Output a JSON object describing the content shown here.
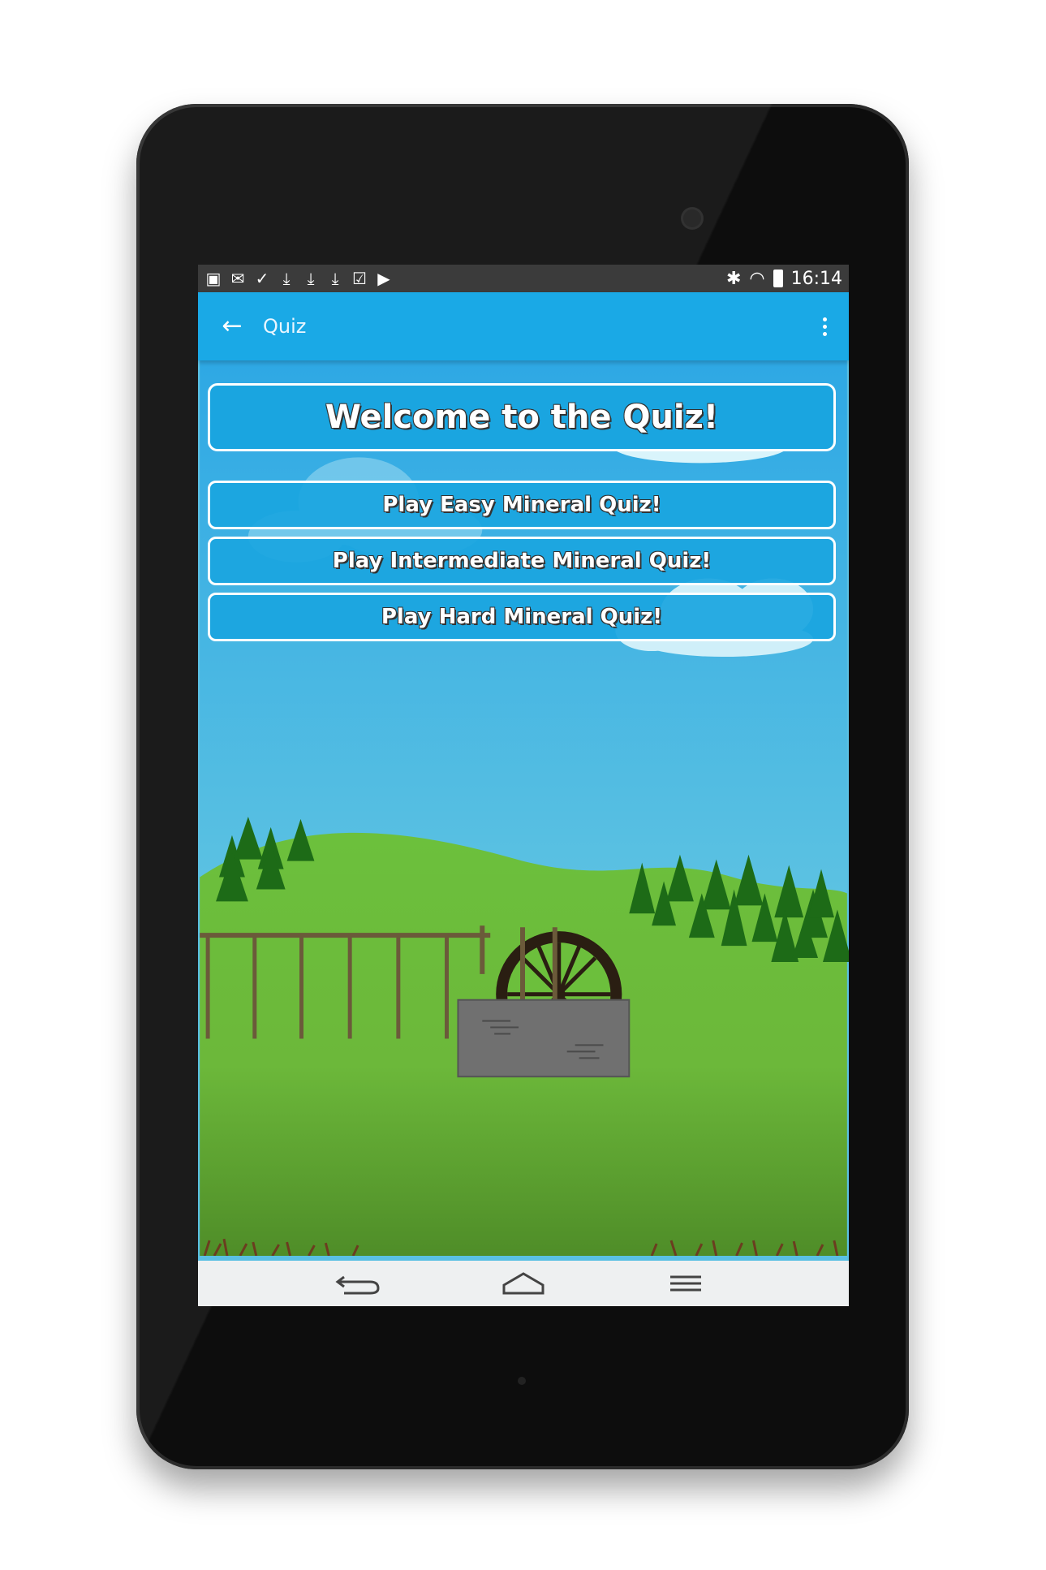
{
  "status_bar": {
    "notification_icons": [
      "image-icon",
      "gmail-icon",
      "check-icon",
      "download-icon",
      "download-icon",
      "download-icon",
      "store-check-icon",
      "store-play-icon"
    ],
    "time": "16:14",
    "system_icons": [
      "bluetooth-icon",
      "wifi-icon",
      "battery-icon"
    ]
  },
  "app_bar": {
    "title": "Quiz",
    "back_icon": "arrow-left-icon",
    "menu_icon": "more-vertical-icon",
    "color": "#1aa9e6"
  },
  "main": {
    "welcome": "Welcome to the Quiz!",
    "buttons": [
      {
        "label": "Play Easy Mineral Quiz!"
      },
      {
        "label": "Play Intermediate Mineral Quiz!"
      },
      {
        "label": "Play Hard Mineral Quiz!"
      }
    ]
  },
  "nav_bar": {
    "icons": [
      "nav-back-icon",
      "nav-home-icon",
      "nav-recents-icon"
    ]
  },
  "colors": {
    "sky": "#5ac0e3",
    "grass": "#6cbf3c",
    "button": "#1aa5e0"
  }
}
